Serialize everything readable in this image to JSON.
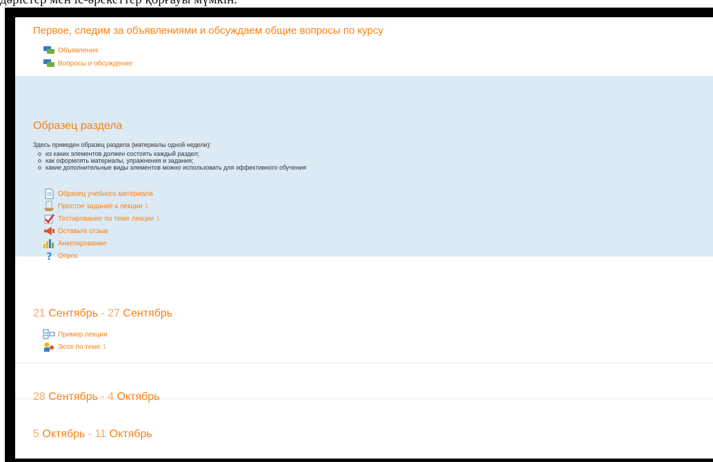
{
  "caption": "дәрістер мен іс-әрекеттер қорғауы мүмкін.",
  "sections": [
    {
      "title": "Первое, следим за объявлениями и обсуждаем общие вопросы по курсу",
      "activities": [
        {
          "label": "Объявления",
          "icon": "forum-icon"
        },
        {
          "label": "Вопросы и обсуждение",
          "icon": "forum-icon"
        }
      ]
    },
    {
      "title": "Образец раздела",
      "summary": "Здесь приведен образец раздела (материалы одной недели):",
      "bullets": [
        "из каких элементов должен состоять каждый раздел;",
        "как оформлять материалы, упражнения и задания;",
        "какие дополнительные виды элементов можно использовать для эффективного обучения"
      ],
      "activities": [
        {
          "label": "Образец учебного материала",
          "icon": "page-icon"
        },
        {
          "label": "Простое задание к лекции",
          "count": "1",
          "icon": "assignment-icon"
        },
        {
          "label": "Тестирование по теме лекции",
          "count": "1",
          "icon": "quiz-icon"
        },
        {
          "label": "Оставьте отзыв",
          "icon": "feedback-icon"
        },
        {
          "label": "Анкетирование",
          "icon": "survey-icon"
        },
        {
          "label": "Опрос",
          "icon": "choice-icon"
        }
      ]
    },
    {
      "date_start_num": "21",
      "date_start_month": "Сентябрь",
      "date_sep": " - ",
      "date_end_num": "27",
      "date_end_month": "Сентябрь",
      "activities": [
        {
          "label": "Пример лекции",
          "icon": "lesson-icon"
        },
        {
          "label": "Эссе по теме",
          "count": "1",
          "icon": "workshop-icon"
        }
      ]
    },
    {
      "date_start_num": "28",
      "date_start_month": "Сентябрь",
      "date_sep": " - ",
      "date_end_num": "4",
      "date_end_month": "Октябрь"
    },
    {
      "date_start_num": "5",
      "date_start_month": "Октябрь",
      "date_sep": " - ",
      "date_end_num": "11",
      "date_end_month": "Октябрь"
    }
  ],
  "colors": {
    "accent": "#f98012",
    "highlight_bg": "#dbeaf4",
    "frame": "#000000"
  }
}
